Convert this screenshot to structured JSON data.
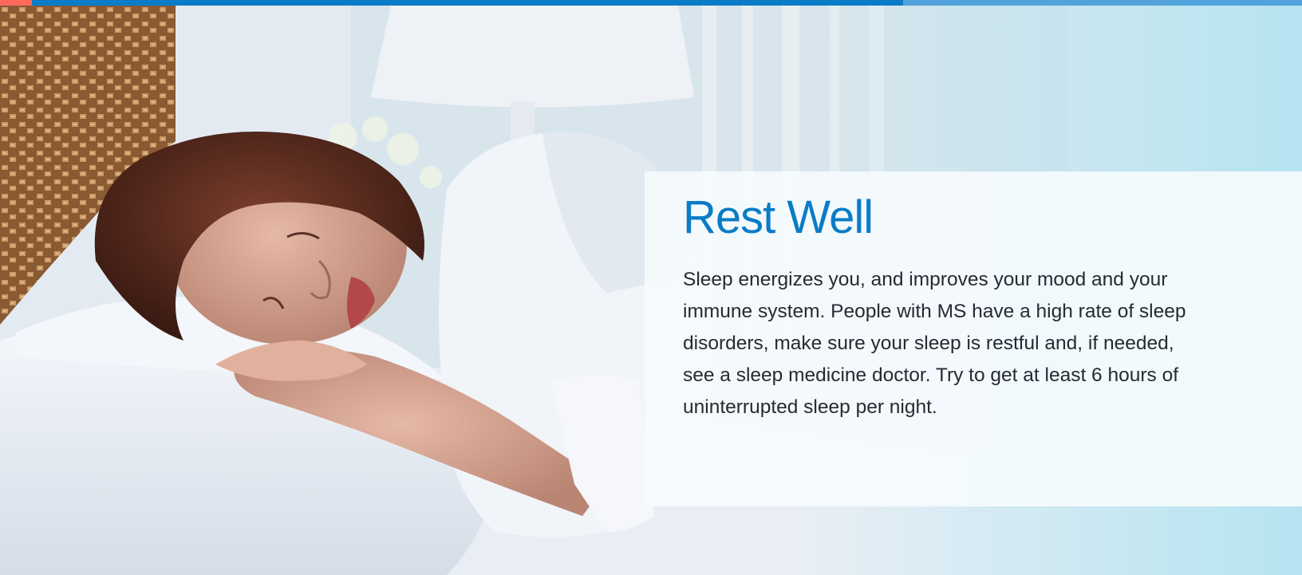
{
  "accent_colors": {
    "red": "#ff6a5c",
    "blue": "#0a7cc7",
    "light_blue": "#52a3dc"
  },
  "hero_image": {
    "subject": "woman sleeping on white pillow in bed"
  },
  "panel": {
    "title": "Rest Well",
    "body": "Sleep energizes you, and improves your mood and your immune system. People with MS have a high rate of sleep disorders, make sure your sleep is restful and, if needed, see a sleep medicine doctor. Try to get at least 6 hours of uninterrupted sleep per night."
  },
  "colors": {
    "title": "#0a7cc7",
    "body_text": "#262b33",
    "background": "#b5e4f0"
  }
}
